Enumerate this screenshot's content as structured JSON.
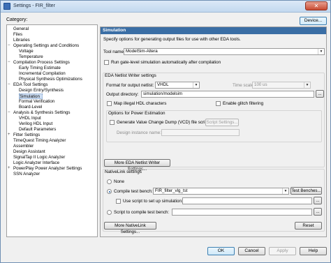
{
  "window": {
    "title": "Settings - FIR_filter",
    "close_glyph": "✕"
  },
  "category_label": "Category:",
  "device_button": "Device...",
  "tree": [
    {
      "label": "General",
      "level": 0,
      "expander": ""
    },
    {
      "label": "Files",
      "level": 0,
      "expander": ""
    },
    {
      "label": "Libraries",
      "level": 0,
      "expander": ""
    },
    {
      "label": "Operating Settings and Conditions",
      "level": 0,
      "expander": "−"
    },
    {
      "label": "Voltage",
      "level": 1,
      "expander": ""
    },
    {
      "label": "Temperature",
      "level": 1,
      "expander": ""
    },
    {
      "label": "Compilation Process Settings",
      "level": 0,
      "expander": "−"
    },
    {
      "label": "Early Timing Estimate",
      "level": 1,
      "expander": ""
    },
    {
      "label": "Incremental Compilation",
      "level": 1,
      "expander": ""
    },
    {
      "label": "Physical Synthesis Optimizations",
      "level": 1,
      "expander": ""
    },
    {
      "label": "EDA Tool Settings",
      "level": 0,
      "expander": "−"
    },
    {
      "label": "Design Entry/Synthesis",
      "level": 1,
      "expander": ""
    },
    {
      "label": "Simulation",
      "level": 1,
      "expander": "",
      "selected": true
    },
    {
      "label": "Formal Verification",
      "level": 1,
      "expander": ""
    },
    {
      "label": "Board-Level",
      "level": 1,
      "expander": ""
    },
    {
      "label": "Analysis & Synthesis Settings",
      "level": 0,
      "expander": "−"
    },
    {
      "label": "VHDL Input",
      "level": 1,
      "expander": ""
    },
    {
      "label": "Verilog HDL Input",
      "level": 1,
      "expander": ""
    },
    {
      "label": "Default Parameters",
      "level": 1,
      "expander": ""
    },
    {
      "label": "Fitter Settings",
      "level": 0,
      "expander": "+"
    },
    {
      "label": "TimeQuest Timing Analyzer",
      "level": 0,
      "expander": ""
    },
    {
      "label": "Assembler",
      "level": 0,
      "expander": ""
    },
    {
      "label": "Design Assistant",
      "level": 0,
      "expander": ""
    },
    {
      "label": "SignalTap II Logic Analyzer",
      "level": 0,
      "expander": ""
    },
    {
      "label": "Logic Analyzer Interface",
      "level": 0,
      "expander": ""
    },
    {
      "label": "PowerPlay Power Analyzer Settings",
      "level": 0,
      "expander": "+"
    },
    {
      "label": "SSN Analyzer",
      "level": 0,
      "expander": ""
    }
  ],
  "panel": {
    "header": "Simulation",
    "description": "Specify options for generating output files for use with other EDA tools.",
    "tool_name_label": "Tool name:",
    "tool_name_value": "ModelSim-Altera",
    "run_gate_level": "Run gate-level simulation automatically after compilation",
    "netlist_section": "EDA Netlist Writer settings",
    "format_label": "Format for output netlist:",
    "format_value": "VHDL",
    "time_scale_label": "Time scale:",
    "time_scale_value": "100 us",
    "output_dir_label": "Output directory:",
    "output_dir_value": "simulation/modelsim",
    "browse": "...",
    "map_illegal": "Map illegal HDL characters",
    "enable_glitch": "Enable glitch filtering",
    "power_section": "Options for Power Estimation",
    "gen_vcd": "Generate Value Change Dump (VCD) file script",
    "script_settings": "Script Settings...",
    "design_instance_label": "Design instance name:",
    "more_netlist": "More EDA Netlist Writer Settings...",
    "nativelink_section": "NativeLink settings",
    "none": "None",
    "compile_tb_label": "Compile test bench:",
    "compile_tb_value": "FIR_filter_vlg_tst",
    "test_benches": "Test Benches...",
    "use_script_label": "Use script to set up simulation:",
    "script_compile_label": "Script to compile test bench:",
    "more_nativelink": "More NativeLink Settings...",
    "reset": "Reset"
  },
  "buttons": {
    "ok": "OK",
    "cancel": "Cancel",
    "apply": "Apply",
    "help": "Help"
  }
}
